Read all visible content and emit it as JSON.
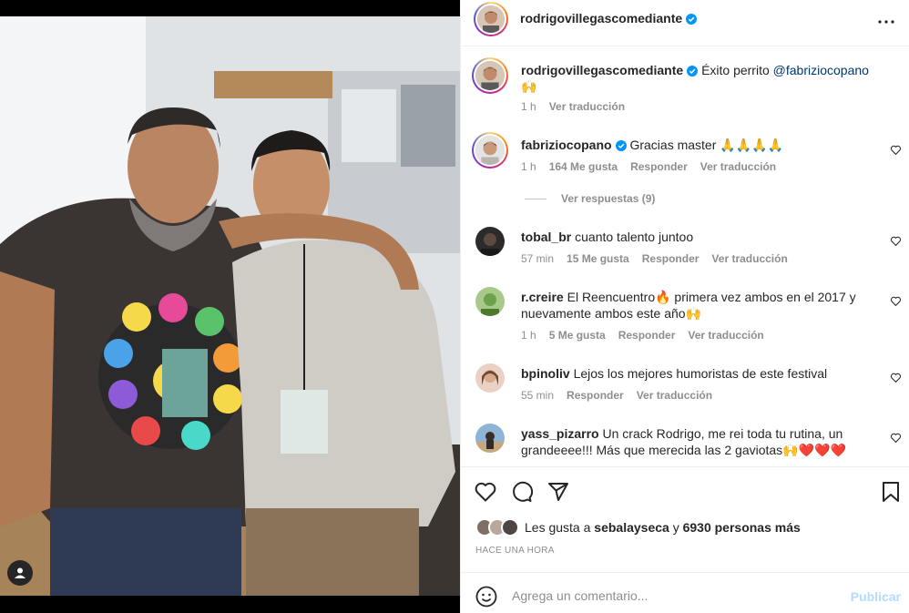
{
  "post": {
    "author": "rodrigovillegascomediante",
    "caption_author": "rodrigovillegascomediante",
    "caption_text": "Éxito perrito ",
    "caption_mention": "@fabriziocopano",
    "caption_emoji": "🙌",
    "caption_time": "1 h",
    "caption_translate": "Ver traducción"
  },
  "comments": [
    {
      "user": "fabriziocopano",
      "verified": true,
      "text": "Gracias master 🙏🙏🙏🙏",
      "time": "1 h",
      "likes": "164 Me gusta",
      "reply": "Responder",
      "translate": "Ver traducción",
      "replies_label": "Ver respuestas (9)"
    },
    {
      "user": "tobal_br",
      "text": "cuanto talento juntoo",
      "time": "57 min",
      "likes": "15 Me gusta",
      "reply": "Responder",
      "translate": "Ver traducción"
    },
    {
      "user": "r.creire",
      "text": "El Reencuentro🔥 primera vez ambos en el 2017 y nuevamente ambos este año🙌",
      "time": "1 h",
      "likes": "5 Me gusta",
      "reply": "Responder",
      "translate": "Ver traducción"
    },
    {
      "user": "bpinoliv",
      "text": "Lejos los mejores humoristas de este festival",
      "time": "55 min",
      "reply": "Responder",
      "translate": "Ver traducción"
    },
    {
      "user": "yass_pizarro",
      "text": "Un crack Rodrigo, me rei toda tu rutina, un grandeeee!!! Más que merecida las 2 gaviotas🙌❤️❤️❤️"
    }
  ],
  "likes": {
    "prefix": "Les gusta a ",
    "first_user": "sebalayseca",
    "connector": " y ",
    "others": "6930 personas más"
  },
  "timestamp": "HACE UNA HORA",
  "comment_box": {
    "placeholder": "Agrega un comentario...",
    "publish": "Publicar"
  },
  "colors": {
    "verified": "#0095f6",
    "mention": "#00376b",
    "publish_disabled": "#b3dbff"
  },
  "icons": {
    "like": "heart-icon",
    "comment": "comment-icon",
    "share": "paper-plane-icon",
    "save": "bookmark-icon",
    "more": "more-options-icon",
    "emoji": "emoji-icon",
    "user_tags": "user-tag-icon"
  }
}
